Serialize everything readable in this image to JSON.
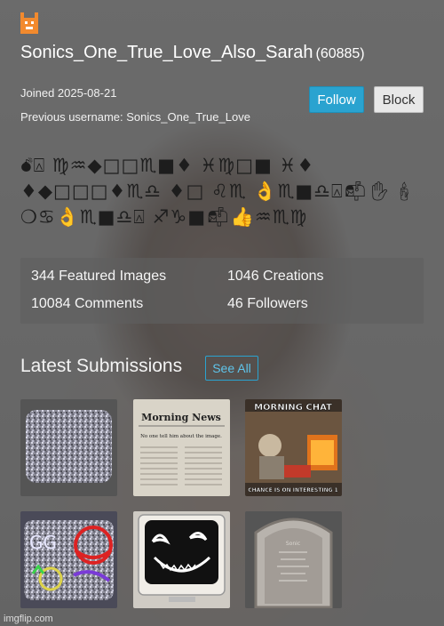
{
  "profile": {
    "username": "Sonics_One_True_Love_Also_Sarah",
    "user_id": "(60885)",
    "joined": "Joined 2025-08-21",
    "previous_username": "Previous username: Sonics_One_True_Love",
    "follow_label": "Follow",
    "block_label": "Block",
    "bio": "💣︎⍓︎ ♍︎♒︎◆︎□︎□︎♏︎■︎♦︎ ♓︎♍︎□︎■︎ ♓︎♦︎ ♦︎◆︎□︎□︎□︎♦︎♏︎♎︎ ♦︎□︎ ♌︎♏︎ 👌♏︎■︎♎︎⍓︎📬︎✋︎🕯︎❍︎♋︎👌♏︎■︎♎︎⍓︎ ♐︎♑︎■︎📬︎👍♒︎♏︎♍︎"
  },
  "stats": {
    "featured_images": "344 Featured Images",
    "creations": "1046 Creations",
    "comments": "10084 Comments",
    "followers": "46 Followers"
  },
  "submissions": {
    "title": "Latest Submissions",
    "see_all_label": "See All",
    "items": [
      {
        "kind": "tv-static"
      },
      {
        "kind": "newspaper",
        "masthead": "Morning News",
        "headline": "No one tell him about the image."
      },
      {
        "kind": "meme",
        "caption_top": "MORNING CHAT",
        "caption_bottom": "CHANCE IS ON INTERESTING 1"
      },
      {
        "kind": "static-faces"
      },
      {
        "kind": "crt-smile"
      },
      {
        "kind": "tombstone",
        "text": "Sonic"
      }
    ]
  },
  "watermark": "imgflip.com",
  "colors": {
    "accent": "#2aa3d0",
    "avatar": "#f28a2e"
  }
}
